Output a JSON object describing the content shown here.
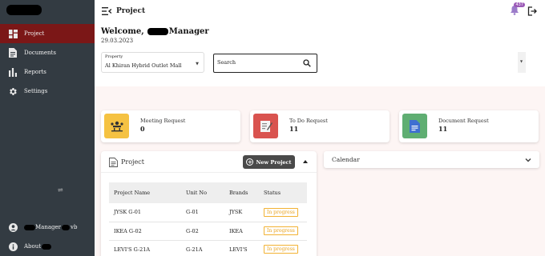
{
  "sidebar": {
    "items": [
      {
        "label": "Project",
        "icon": "dashboard-icon",
        "active": true
      },
      {
        "label": "Documents",
        "icon": "document-icon"
      },
      {
        "label": "Reports",
        "icon": "bar-chart-icon"
      },
      {
        "label": "Settings",
        "icon": "gear-icon"
      }
    ],
    "misc_glyph": "⇌",
    "user_name_prefix": "Manager",
    "user_name_suffix": "vb",
    "about_label": "About"
  },
  "topbar": {
    "title": "Project",
    "notification_count": "437"
  },
  "header": {
    "welcome_prefix": "Welcome,",
    "welcome_suffix": "Manager",
    "date": "29.03.2023",
    "property_label": "Property",
    "property_value": "Al Khiran Hybrid Outlet Mall",
    "search_placeholder": "Search"
  },
  "cards": [
    {
      "title": "Meeting Request",
      "value": "0",
      "color": "#f5c242",
      "icon": "meeting-icon"
    },
    {
      "title": "To Do Request",
      "value": "11",
      "color": "#d9534f",
      "icon": "todo-icon"
    },
    {
      "title": "Document Request",
      "value": "11",
      "color": "#5fae72",
      "icon": "document-request-icon"
    }
  ],
  "project_panel": {
    "title": "Project",
    "new_button": "New Project",
    "columns": [
      "Project Name",
      "Unit No",
      "Brands",
      "Status"
    ],
    "rows": [
      {
        "name": "JYSK G-01",
        "unit": "G-01",
        "brand": "JYSK",
        "status": "In progress"
      },
      {
        "name": "IKEA G-02",
        "unit": "G-02",
        "brand": "IKEA",
        "status": "In progress"
      },
      {
        "name": "LEVI'S G-21A",
        "unit": "G-21A",
        "brand": "LEVI'S",
        "status": "In progress"
      }
    ]
  },
  "calendar": {
    "title": "Calendar"
  },
  "colors": {
    "sidebar_bg": "#333b42",
    "active_nav": "#7b1717",
    "status_border": "#f2b233",
    "badge": "#9b59b6"
  }
}
